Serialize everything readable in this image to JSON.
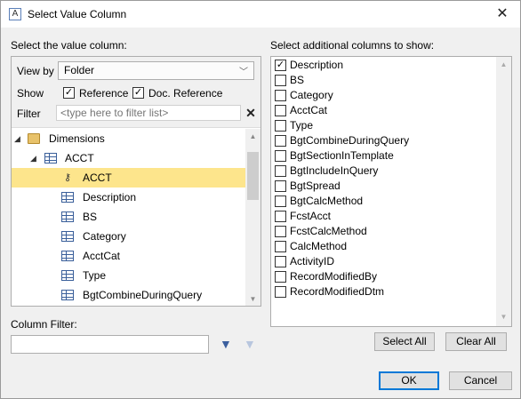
{
  "window": {
    "title": "Select Value Column",
    "app_icon_letter": "A"
  },
  "left": {
    "heading": "Select the value column:",
    "view_by_label": "View by",
    "view_by_value": "Folder",
    "show_label": "Show",
    "show_options": [
      {
        "label": "Reference",
        "checked": true
      },
      {
        "label": "Doc. Reference",
        "checked": true
      }
    ],
    "filter_label": "Filter",
    "filter_placeholder": "<type here to filter list>",
    "tree": [
      {
        "label": "Dimensions",
        "icon": "folder-icon",
        "level": 0,
        "expanded": true,
        "selected": false
      },
      {
        "label": "ACCT",
        "icon": "dimension-table-icon",
        "level": 1,
        "expanded": true,
        "selected": false
      },
      {
        "label": "ACCT",
        "icon": "key-icon",
        "level": 2,
        "selected": true
      },
      {
        "label": "Description",
        "icon": "column-icon",
        "level": 2,
        "selected": false
      },
      {
        "label": "BS",
        "icon": "column-icon",
        "level": 2,
        "selected": false
      },
      {
        "label": "Category",
        "icon": "column-icon",
        "level": 2,
        "selected": false
      },
      {
        "label": "AcctCat",
        "icon": "column-icon",
        "level": 2,
        "selected": false
      },
      {
        "label": "Type",
        "icon": "column-icon",
        "level": 2,
        "selected": false
      },
      {
        "label": "BgtCombineDuringQuery",
        "icon": "column-icon",
        "level": 2,
        "selected": false
      }
    ]
  },
  "column_filter": {
    "label": "Column Filter:",
    "value": ""
  },
  "right": {
    "heading": "Select additional columns to show:",
    "columns": [
      {
        "label": "Description",
        "checked": true
      },
      {
        "label": "BS",
        "checked": false
      },
      {
        "label": "Category",
        "checked": false
      },
      {
        "label": "AcctCat",
        "checked": false
      },
      {
        "label": "Type",
        "checked": false
      },
      {
        "label": "BgtCombineDuringQuery",
        "checked": false
      },
      {
        "label": "BgtSectionInTemplate",
        "checked": false
      },
      {
        "label": "BgtIncludeInQuery",
        "checked": false
      },
      {
        "label": "BgtSpread",
        "checked": false
      },
      {
        "label": "BgtCalcMethod",
        "checked": false
      },
      {
        "label": "FcstAcct",
        "checked": false
      },
      {
        "label": "FcstCalcMethod",
        "checked": false
      },
      {
        "label": "CalcMethod",
        "checked": false
      },
      {
        "label": "ActivityID",
        "checked": false
      },
      {
        "label": "RecordModifiedBy",
        "checked": false
      },
      {
        "label": "RecordModifiedDtm",
        "checked": false
      }
    ],
    "select_all_label": "Select All",
    "clear_all_label": "Clear All"
  },
  "footer": {
    "ok_label": "OK",
    "cancel_label": "Cancel"
  },
  "colors": {
    "selection": "#fde58c",
    "accent": "#0078d7"
  }
}
